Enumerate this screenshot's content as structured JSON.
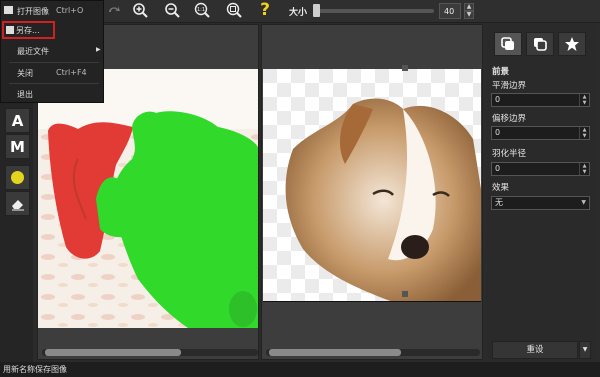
{
  "menu": {
    "items": [
      {
        "label": "打开图像",
        "shortcut": "Ctrl+O"
      },
      {
        "label": "另存...",
        "shortcut": ""
      },
      {
        "label": "最近文件",
        "shortcut": ""
      },
      {
        "label": "关闭",
        "shortcut": "Ctrl+F4"
      },
      {
        "label": "退出",
        "shortcut": ""
      }
    ]
  },
  "toolbar": {
    "size_label": "大小",
    "size_value": "40",
    "size_level": 0.05,
    "help_icon": "?"
  },
  "tools": {
    "auto_label": "A",
    "manual_label": "M"
  },
  "side_panel": {
    "section_title": "前景",
    "smooth_label": "平滑边界",
    "smooth_value": "0",
    "offset_label": "偏移边界",
    "offset_value": "0",
    "feather_label": "羽化半径",
    "feather_value": "0",
    "effect_label": "效果",
    "effect_value": "无",
    "reset_label": "重设"
  },
  "status": {
    "text": "用新名称保存图像"
  },
  "colors": {
    "highlight_box": "#d21f1f",
    "green_mask": "#31d92b",
    "red_mask": "#e23a35",
    "marker_yellow": "#e3d51e"
  }
}
